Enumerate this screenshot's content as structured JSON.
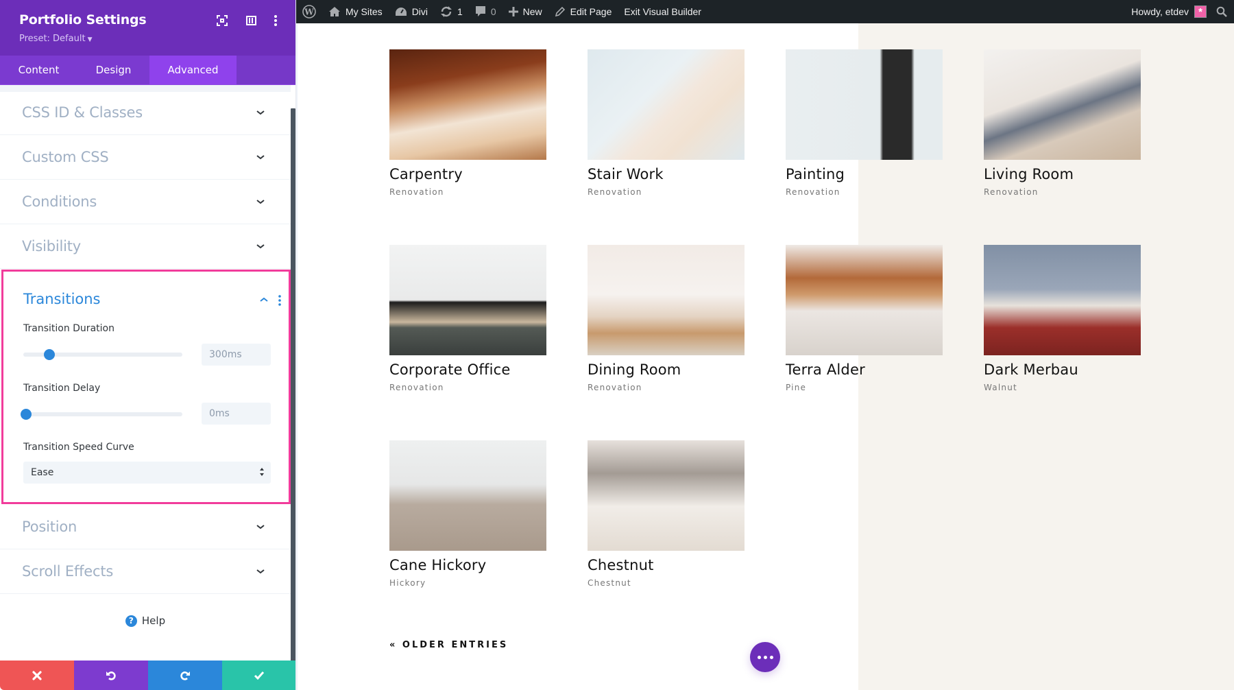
{
  "adminbar": {
    "wp_logo": "wordpress-logo-icon",
    "my_sites": "My Sites",
    "site_name": "Divi",
    "updates_count": "1",
    "comments_count": "0",
    "new_label": "New",
    "edit_page": "Edit Page",
    "exit_builder": "Exit Visual Builder",
    "greeting": "Howdy, etdev",
    "avatar_glyph": "*"
  },
  "sidebar": {
    "title": "Portfolio Settings",
    "preset": "Preset: Default",
    "tabs": [
      {
        "label": "Content",
        "active": false
      },
      {
        "label": "Design",
        "active": false
      },
      {
        "label": "Advanced",
        "active": true
      }
    ],
    "sections_top": [
      {
        "label": "CSS ID & Classes"
      },
      {
        "label": "Custom CSS"
      },
      {
        "label": "Conditions"
      },
      {
        "label": "Visibility"
      }
    ],
    "transitions": {
      "title": "Transitions",
      "duration_label": "Transition Duration",
      "duration_value": "300ms",
      "duration_fraction": 0.15,
      "delay_label": "Transition Delay",
      "delay_value": "0ms",
      "delay_fraction": 0.0,
      "curve_label": "Transition Speed Curve",
      "curve_value": "Ease"
    },
    "sections_bottom": [
      {
        "label": "Position"
      },
      {
        "label": "Scroll Effects"
      }
    ],
    "help_label": "Help",
    "help_icon": "?"
  },
  "colors": {
    "divi_purple": "#6c2eb9",
    "tab_active": "#8f42ec",
    "accent_blue": "#2b87da",
    "highlight_pink": "#f13c9b",
    "cancel_red": "#ef5555",
    "save_teal": "#29c4a9",
    "beige_bg": "#f6f3ee"
  },
  "portfolio": {
    "items": [
      {
        "title": "Carpentry",
        "category": "Renovation",
        "image": "carpentry-photo"
      },
      {
        "title": "Stair Work",
        "category": "Renovation",
        "image": "paint-roller-photo"
      },
      {
        "title": "Painting",
        "category": "Renovation",
        "image": "paintbrush-photo"
      },
      {
        "title": "Living Room",
        "category": "Renovation",
        "image": "knit-blanket-sofa-photo"
      },
      {
        "title": "Corporate Office",
        "category": "Renovation",
        "image": "desk-laptops-photo"
      },
      {
        "title": "Dining Room",
        "category": "Renovation",
        "image": "vase-decor-photo"
      },
      {
        "title": "Terra Alder",
        "category": "Pine",
        "image": "leather-chair-plant-photo"
      },
      {
        "title": "Dark Merbau",
        "category": "Walnut",
        "image": "basket-blanket-floor-photo"
      },
      {
        "title": "Cane Hickory",
        "category": "Hickory",
        "image": "white-chair-floor-photo"
      },
      {
        "title": "Chestnut",
        "category": "Chestnut",
        "image": "armchair-rug-photo"
      }
    ],
    "older_entries": "« OLDER ENTRIES"
  }
}
